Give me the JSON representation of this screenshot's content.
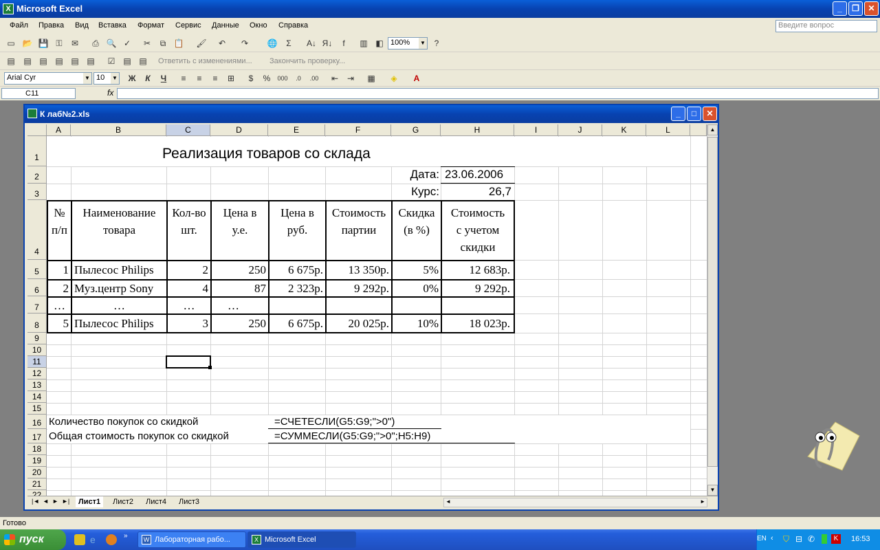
{
  "app": {
    "title": "Microsoft Excel",
    "help_placeholder": "Введите вопрос"
  },
  "menu": [
    "Файл",
    "Правка",
    "Вид",
    "Вставка",
    "Формат",
    "Сервис",
    "Данные",
    "Окно",
    "Справка"
  ],
  "toolbar": {
    "zoom": "100%",
    "font_name": "Arial Cyr",
    "font_size": "10",
    "reply_changes": "Ответить с изменениями...",
    "end_review": "Закончить проверку...",
    "bold": "Ж",
    "italic": "К",
    "underline": "Ч"
  },
  "formula_bar": {
    "name_box": "C11",
    "fx": "fx",
    "formula": ""
  },
  "workbook": {
    "title": "К лаб№2.xls",
    "columns": [
      "A",
      "B",
      "C",
      "D",
      "E",
      "F",
      "G",
      "H",
      "I",
      "J",
      "K",
      "L"
    ],
    "rows": [
      "1",
      "2",
      "3",
      "4",
      "5",
      "6",
      "7",
      "8",
      "9",
      "10",
      "11",
      "12",
      "13",
      "14",
      "15",
      "16",
      "17",
      "18",
      "19",
      "20",
      "21",
      "22"
    ],
    "title_cell": "Реализация товаров со склада",
    "date_label": "Дата:",
    "date_value": "23.06.2006",
    "rate_label": "Курс:",
    "rate_value": "26,7",
    "headers": {
      "num": [
        "№",
        "п/п"
      ],
      "name": [
        "Наименование",
        "товара"
      ],
      "qty": [
        "Кол-во",
        "шт."
      ],
      "price_ue": [
        "Цена в",
        "у.е."
      ],
      "price_rub": [
        "Цена в",
        "руб."
      ],
      "cost": [
        "Стоимость",
        "партии"
      ],
      "discount": [
        "Скидка",
        "(в %)"
      ],
      "total": [
        "Стоимость",
        "с учетом",
        "скидки"
      ]
    },
    "data_rows": [
      {
        "num": "1",
        "name": "Пылесос Philips",
        "qty": "2",
        "price_ue": "250",
        "price_rub": "6 675р.",
        "cost": "13 350р.",
        "discount": "5%",
        "total": "12 683р."
      },
      {
        "num": "2",
        "name": "Муз.центр Sony",
        "qty": "4",
        "price_ue": "87",
        "price_rub": "2 323р.",
        "cost": "9 292р.",
        "discount": "0%",
        "total": "9 292р."
      },
      {
        "num": "…",
        "name": "…",
        "qty": "…",
        "price_ue": "…",
        "price_rub": "",
        "cost": "",
        "discount": "",
        "total": ""
      },
      {
        "num": "5",
        "name": "Пылесос Philips",
        "qty": "3",
        "price_ue": "250",
        "price_rub": "6 675р.",
        "cost": "20 025р.",
        "discount": "10%",
        "total": "18 023р."
      }
    ],
    "row16_label": "Количество покупок со скидкой",
    "row16_formula": "=СЧЕТЕСЛИ(G5:G9;\">0\")",
    "row17_label": "Общая стоимость покупок со скидкой",
    "row17_formula": "=СУММЕСЛИ(G5:G9;\">0\";H5:H9)",
    "sheets": [
      "Лист1",
      "Лист2",
      "Лист4",
      "Лист3"
    ],
    "active_sheet": "Лист1"
  },
  "status": "Готово",
  "taskbar": {
    "start": "пуск",
    "tasks": [
      "Лабораторная рабо...",
      "Microsoft Excel"
    ],
    "lang": "EN",
    "clock": "16:53"
  }
}
